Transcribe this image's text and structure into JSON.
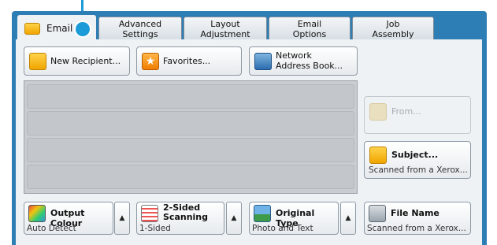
{
  "tabs": [
    {
      "label": "Email"
    },
    {
      "label": "Advanced\nSettings"
    },
    {
      "label": "Layout\nAdjustment"
    },
    {
      "label": "Email\nOptions"
    },
    {
      "label": "Job\nAssembly"
    }
  ],
  "top_buttons": {
    "new_recipient": "New Recipient...",
    "favorites": "Favorites...",
    "network_address_book": "Network\nAddress Book..."
  },
  "side": {
    "from_label": "From...",
    "subject_label": "Subject...",
    "subject_value": "Scanned from a Xerox..."
  },
  "bottom_features": [
    {
      "label": "Output Colour",
      "value": "Auto Detect"
    },
    {
      "label": "2-Sided\nScanning",
      "value": "1-Sided"
    },
    {
      "label": "Original Type",
      "value": "Photo and Text"
    },
    {
      "label": "File Name",
      "value": "Scanned from a Xerox..."
    }
  ],
  "colors": {
    "accent": "#1b9bd7",
    "frame": "#2e7eb6"
  }
}
